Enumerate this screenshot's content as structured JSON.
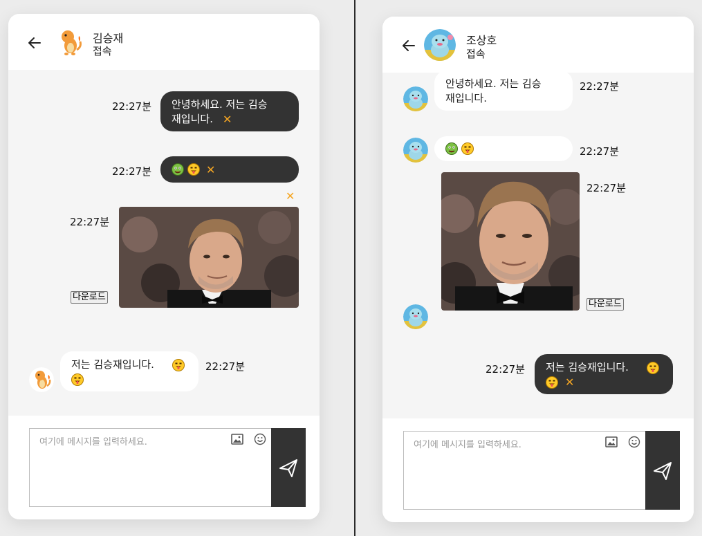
{
  "left": {
    "header": {
      "name": "김승재",
      "status": "접속"
    },
    "messages": [
      {
        "time": "22:27분",
        "text_line1": "안녕하세요. 저는 김승",
        "text_line2": "재입니다."
      },
      {
        "time": "22:27분"
      },
      {
        "time": "22:27분",
        "download": "다운로드"
      },
      {
        "time": "22:27분",
        "text": "저는 김승재입니다."
      }
    ],
    "input": {
      "placeholder": "여기에 메시지를 입력하세요."
    }
  },
  "right": {
    "header": {
      "name": "조상호",
      "status": "접속"
    },
    "messages": [
      {
        "time": "22:27분",
        "text_line1": "안녕하세요. 저는 김승",
        "text_line2": "재입니다."
      },
      {
        "time": "22:27분"
      },
      {
        "time": "22:27분",
        "download": "다운로드"
      },
      {
        "time": "22:27분",
        "text": "저는 김승재입니다."
      }
    ],
    "input": {
      "placeholder": "여기에 메시지를 입력하세요."
    }
  },
  "icons": {
    "delete": "✕",
    "back": "arrow-left-icon",
    "send": "paper-plane-icon",
    "image": "image-icon",
    "emoji": "smile-icon"
  },
  "colors": {
    "accent": "#f5a623",
    "dark_bubble": "#333333",
    "panel": "#f5f5f5"
  }
}
